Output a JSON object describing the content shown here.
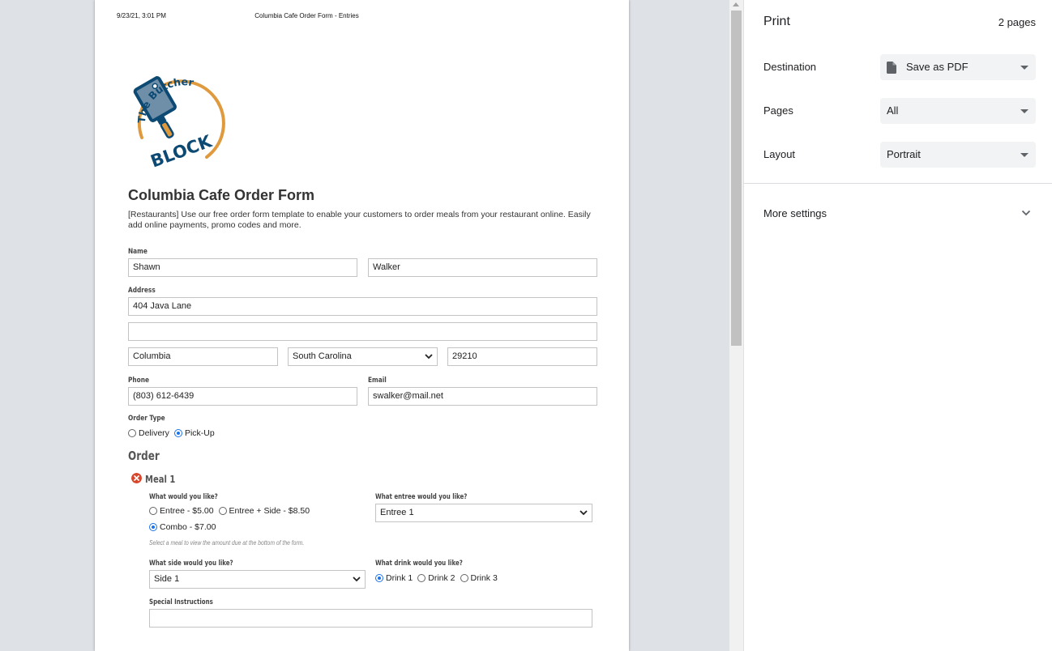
{
  "page_header": {
    "datetime": "9/23/21, 3:01 PM",
    "title": "Columbia Cafe Order Form - Entries"
  },
  "logo": {
    "text_top": "The Butcher",
    "text_bottom": "BLOCK",
    "colors": {
      "navy": "#0d4a73",
      "orange": "#e09a3e",
      "steel": "#6f8fa8"
    }
  },
  "form": {
    "title": "Columbia Cafe Order Form",
    "description": "[Restaurants] Use our free order form template to enable your customers to order meals from your restaurant online. Easily add online payments, promo codes and more.",
    "name_label": "Name",
    "first_name": "Shawn",
    "last_name": "Walker",
    "address_label": "Address",
    "address_line1": "404 Java Lane",
    "address_line2": "",
    "city": "Columbia",
    "state": "South Carolina",
    "zip": "29210",
    "phone_label": "Phone",
    "phone": "(803) 612-6439",
    "email_label": "Email",
    "email": "swalker@mail.net",
    "order_type_label": "Order Type",
    "order_type_options": [
      "Delivery",
      "Pick-Up"
    ],
    "order_type_selected": "Pick-Up"
  },
  "order": {
    "heading": "Order",
    "meal_title": "Meal 1",
    "meal_question": "What would you like?",
    "meal_options": [
      "Entree - $5.00",
      "Entree + Side - $8.50",
      "Combo - $7.00"
    ],
    "meal_selected": "Combo - $7.00",
    "meal_hint": "Select a meal to view the amount due at the bottom of the form.",
    "entree_question": "What entree would you like?",
    "entree_value": "Entree 1",
    "side_question": "What side would you like?",
    "side_value": "Side 1",
    "drink_question": "What drink would you like?",
    "drink_options": [
      "Drink 1",
      "Drink 2",
      "Drink 3"
    ],
    "drink_selected": "Drink 1",
    "instructions_label": "Special Instructions",
    "instructions_value": ""
  },
  "print_panel": {
    "title": "Print",
    "page_count": "2 pages",
    "destination_label": "Destination",
    "destination_value": "Save as PDF",
    "pages_label": "Pages",
    "pages_value": "All",
    "layout_label": "Layout",
    "layout_value": "Portrait",
    "more_settings": "More settings"
  }
}
